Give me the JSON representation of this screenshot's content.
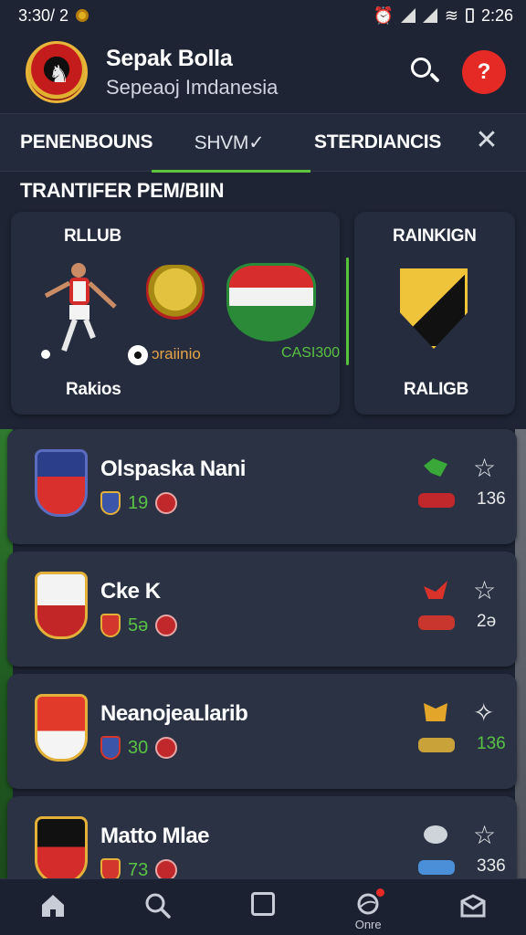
{
  "status_bar": {
    "time_left": "3:30/ 2",
    "time_right": "2:26"
  },
  "header": {
    "title": "Sepak Bolla",
    "subtitle": "Sepeaoj Imdanesia",
    "alert_glyph": "?"
  },
  "tabs": [
    {
      "label": "PENENBOUNS"
    },
    {
      "label": "SHVM✓"
    },
    {
      "label": "STERDIANCIS"
    }
  ],
  "close_glyph": "✕",
  "section_title": "TRANTIFER PEM/BIIN",
  "featured": {
    "top_label": "RLLUB",
    "bottom_label": "Rakios",
    "tag_orange": "ɔraiinio",
    "tag_green": "CASI300"
  },
  "ranking": {
    "top_label": "RAINKIGN",
    "bottom_label": "RALIGB"
  },
  "rows": [
    {
      "name": "Olspaska Nani",
      "number": "19",
      "score": "136",
      "accent": "#3aa838",
      "star": "☆"
    },
    {
      "name": "Cke K",
      "number": "5ə",
      "score": "2ə",
      "accent": "#d9322b",
      "star": "☆"
    },
    {
      "name": "Neanojeaʟlarib",
      "number": "30",
      "score": "136",
      "accent": "#e3a62a",
      "star": "✧"
    },
    {
      "name": "Matto Mlae",
      "number": "73",
      "score": "336",
      "accent": "#4a8fd8",
      "star": "☆"
    }
  ],
  "bottom_nav": [
    {
      "icon": "home-icon",
      "label": ""
    },
    {
      "icon": "search-icon",
      "label": ""
    },
    {
      "icon": "square-icon",
      "label": ""
    },
    {
      "icon": "globe-icon",
      "label": "Onre"
    },
    {
      "icon": "mail-icon",
      "label": ""
    }
  ],
  "colors": {
    "accent_green": "#5dc53c",
    "alert_red": "#e52a25",
    "card_bg": "#252c3d"
  }
}
